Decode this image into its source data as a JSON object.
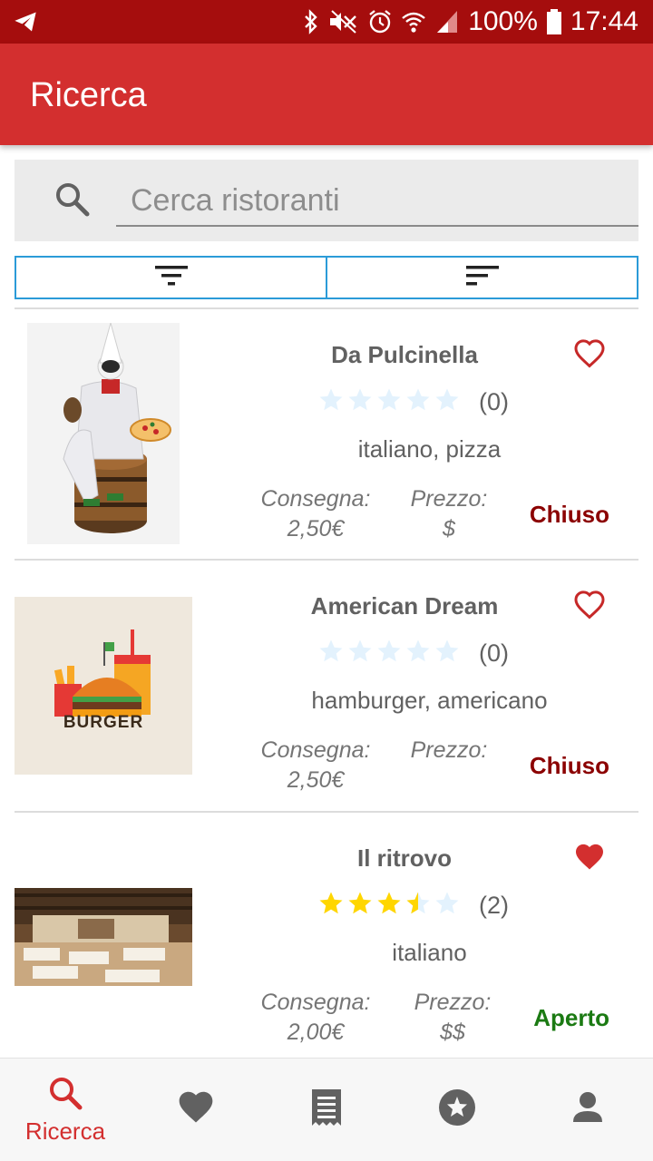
{
  "status_bar": {
    "battery": "100%",
    "time": "17:44",
    "icons": [
      "telegram-icon",
      "bluetooth-icon",
      "mute-icon",
      "alarm-icon",
      "wifi-icon",
      "signal-icon",
      "battery-icon"
    ]
  },
  "header": {
    "title": "Ricerca"
  },
  "search": {
    "placeholder": "Cerca ristoranti",
    "value": ""
  },
  "toolbar": {
    "buttons": [
      "filter-icon",
      "sort-icon"
    ]
  },
  "restaurants": [
    {
      "name": "Da Pulcinella",
      "rating": 0,
      "reviews": "(0)",
      "cuisine": "italiano, pizza",
      "delivery_label": "Consegna:",
      "delivery_value": "2,50€",
      "price_label": "Prezzo:",
      "price_value": "$",
      "status": "Chiuso",
      "favorite": false
    },
    {
      "name": "American Dream",
      "rating": 0,
      "reviews": "(0)",
      "cuisine": "hamburger, americano",
      "delivery_label": "Consegna:",
      "delivery_value": "2,50€",
      "price_label": "Prezzo:",
      "price_value": "",
      "status": "Chiuso",
      "favorite": false,
      "logo_text": "BURGER"
    },
    {
      "name": "Il ritrovo",
      "rating": 3.5,
      "reviews": "(2)",
      "cuisine": "italiano",
      "delivery_label": "Consegna:",
      "delivery_value": "2,00€",
      "price_label": "Prezzo:",
      "price_value": "$$",
      "status": "Aperto",
      "favorite": true
    }
  ],
  "bottom_nav": {
    "active_label": "Ricerca",
    "items": [
      "search-icon",
      "heart-icon",
      "receipt-icon",
      "star-icon",
      "person-icon"
    ]
  },
  "colors": {
    "primary": "#d32f2f",
    "status_bar": "#a50d0d",
    "closed": "#8b0000",
    "open": "#1b7a13",
    "star_filled": "#ffd600",
    "star_empty": "#e3f2fd",
    "accent_border": "#2b9bd8"
  }
}
